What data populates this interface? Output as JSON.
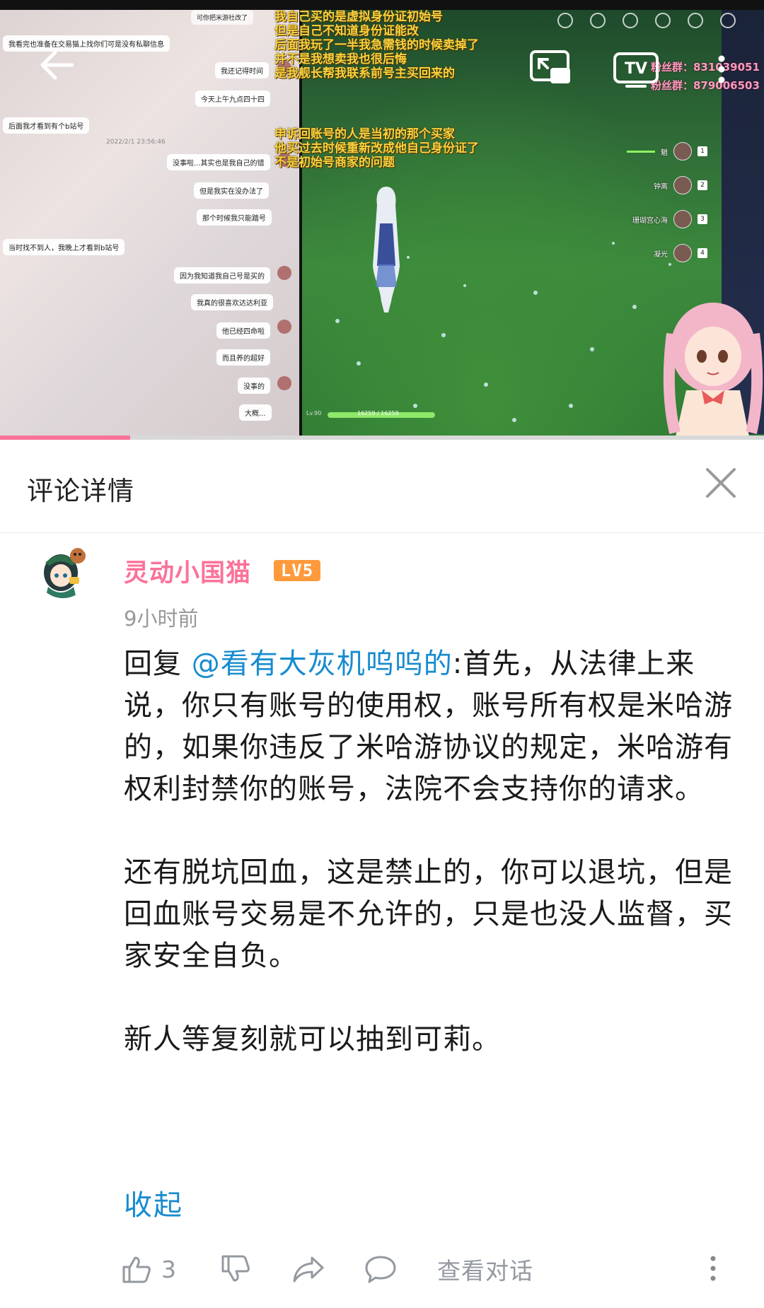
{
  "video": {
    "chat_messages": [
      {
        "side": "left",
        "text": "我看完也准备在交易猫上找你们可是没有私聊信息"
      },
      {
        "side": "right",
        "text": "我还记得时间"
      },
      {
        "side": "right",
        "text": "今天上午九点四十四"
      },
      {
        "side": "left",
        "text": "后面我才看到有个b站号"
      },
      {
        "side": "time",
        "text": "2022/2/1 23:56:46"
      },
      {
        "side": "right",
        "text": "没事啦...其实也是我自己的错"
      },
      {
        "side": "right",
        "text": "但是我实在没办法了"
      },
      {
        "side": "right",
        "text": "那个时候我只能踏号"
      },
      {
        "side": "left",
        "text": "当时找不到人，我晚上才看到b站号"
      },
      {
        "side": "right",
        "text": "因为我知道我自己号是买的"
      },
      {
        "side": "right",
        "text": "我真的很喜欢达达利亚"
      },
      {
        "side": "right",
        "text": "他已经四命啦"
      },
      {
        "side": "right",
        "text": "而且养的超好"
      },
      {
        "side": "right",
        "text": "没事的"
      },
      {
        "side": "right",
        "text": "大概..."
      }
    ],
    "overlay_lines_top": [
      "我自己买的是虚拟身份证初始号",
      "但是自己不知道身份证能改",
      "后面我玩了一半我急需钱的时候卖掉了",
      "并不是我想卖我也很后悔",
      "是我舰长帮我联系前号主买回来的"
    ],
    "overlay_lines_mid": [
      "申诉回账号的人是当初的那个买家",
      "他买过去时候重新改成他自己身份证了",
      "不是初始号商家的问题"
    ],
    "fan_groups": [
      "粉丝群：831039051",
      "粉丝群：879006503"
    ],
    "party": [
      {
        "name": "魈",
        "num": "1"
      },
      {
        "name": "钟离",
        "num": "2"
      },
      {
        "name": "珊瑚宫心海",
        "num": "3"
      },
      {
        "name": "凝光",
        "num": "4"
      }
    ],
    "hud_level": "Lv.90",
    "hud_hp": "16259 / 16259",
    "progress_fraction": 0.17,
    "chat_header_text": "可你把米游社改了"
  },
  "panel": {
    "title": "评论详情"
  },
  "comment": {
    "username": "灵动小国猫",
    "level_badge": "LV5",
    "time": "9小时前",
    "reply_prefix": "回复 ",
    "mention": "@看有大灰机呜呜的",
    "paragraph1_rest": ":首先，从法律上来说，你只有账号的使用权，账号所有权是米哈游的，如果你违反了米哈游协议的规定，米哈游有权利封禁你的账号，法院不会支持你的请求。",
    "paragraph2": "还有脱坑回血，这是禁止的，你可以退坑，但是回血账号交易是不允许的，只是也没人监督，买家安全自负。",
    "paragraph3": "新人等复刻就可以抽到可莉。",
    "collapse_label": "收起",
    "like_count": "3",
    "view_conversation_label": "查看对话"
  },
  "colors": {
    "brand_pink": "#fb7299",
    "link_blue": "#178bcf",
    "level_orange": "#ff9a3c",
    "icon_gray": "#9499a0"
  }
}
